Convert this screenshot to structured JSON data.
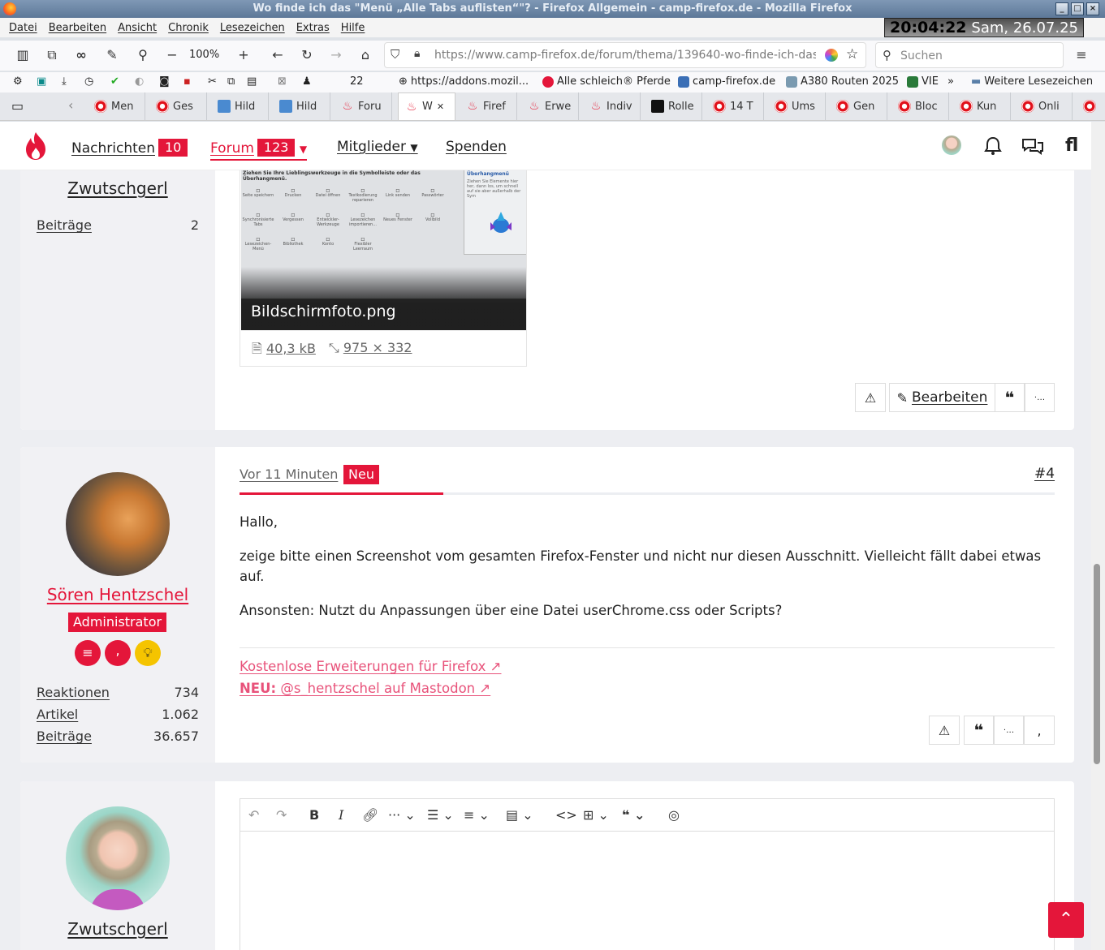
{
  "window": {
    "title": "Wo finde ich das \"Menü „Alle Tabs auflisten“\"? - Firefox Allgemein - camp-firefox.de - Mozilla Firefox"
  },
  "menubar": [
    "Datei",
    "Bearbeiten",
    "Ansicht",
    "Chronik",
    "Lesezeichen",
    "Extras",
    "Hilfe"
  ],
  "clock": {
    "time": "20:04:22",
    "date": "Sam, 26.07.25"
  },
  "navbar": {
    "zoom": "100%",
    "url": "https://www.camp-firefox.de/forum/thema/139640-wo-finde-ich-das",
    "search_placeholder": "Suchen"
  },
  "bookmarks": {
    "counter": "22",
    "items": [
      "https://addons.mozil...",
      "Alle schleich® Pferde",
      "camp-firefox.de",
      "A380 Routen 2025",
      "VIE"
    ],
    "more": "Weitere Lesezeichen"
  },
  "tabs": [
    "Men",
    "Ges",
    "Hild",
    "Hild",
    "Foru",
    "W",
    "Firef",
    "Erwe",
    "Indiv",
    "Rolle",
    "14 T",
    "Ums",
    "Gen",
    "Bloc",
    "Kun",
    "Onli",
    ""
  ],
  "site": {
    "nav": {
      "nachrichten": "Nachrichten",
      "nachrichten_count": "10",
      "forum": "Forum",
      "forum_count": "123",
      "mitglieder": "Mitglieder",
      "spenden": "Spenden"
    }
  },
  "post_prev": {
    "author": "Zwutschgerl",
    "stat_label": "Beiträge",
    "stat_value": "2",
    "attachment": {
      "filename": "Bildschirmfoto.png",
      "size": "40,3 kB",
      "dimensions": "975 × 332",
      "preview_heading": "Ziehen Sie Ihre Lieblingswerkzeuge in die Symbolleiste oder das Überhangmenü.",
      "overflow_title": "Überhangmenü",
      "overflow_text": "Ziehen Sie Elemente hier her, dann los, um schnell auf sie aber außerhalb der Sym",
      "preview_items": [
        "Seite speichern",
        "Drucken",
        "Datei öffnen",
        "Textkodierung reparieren",
        "Link senden",
        "Passwörter",
        "Synchronisierte Tabs",
        "Vergessen",
        "Entwickler-Werkzeuge",
        "Lesezeichen importieren...",
        "Neues Fenster",
        "Vollbild",
        "Lesezeichen-Menü",
        "Bibliothek",
        "Konto",
        "Flexibler Leerraum"
      ]
    },
    "edit_label": "Bearbeiten"
  },
  "post4": {
    "time": "Vor 11 Minuten",
    "new_badge": "Neu",
    "number": "#4",
    "author": "Sören Hentzschel",
    "role": "Administrator",
    "stats": [
      {
        "label": "Reaktionen",
        "value": "734"
      },
      {
        "label": "Artikel",
        "value": "1.062"
      },
      {
        "label": "Beiträge",
        "value": "36.657"
      }
    ],
    "body": [
      "Hallo,",
      "zeige bitte einen Screenshot vom gesamten Firefox-Fenster und nicht nur diesen Ausschnitt. Vielleicht fällt dabei etwas auf.",
      "Ansonsten: Nutzt du Anpassungen über eine Datei userChrome.css oder Scripts?"
    ],
    "signature_link1": "Kostenlose Erweiterungen für Firefox ↗",
    "signature_link2_bold": "NEU:",
    "signature_link2": " @s_hentzschel auf Mastodon ↗"
  },
  "reply": {
    "author": "Zwutschgerl"
  },
  "colors": {
    "accent": "#e4163a",
    "link_pink": "#e8527a"
  }
}
